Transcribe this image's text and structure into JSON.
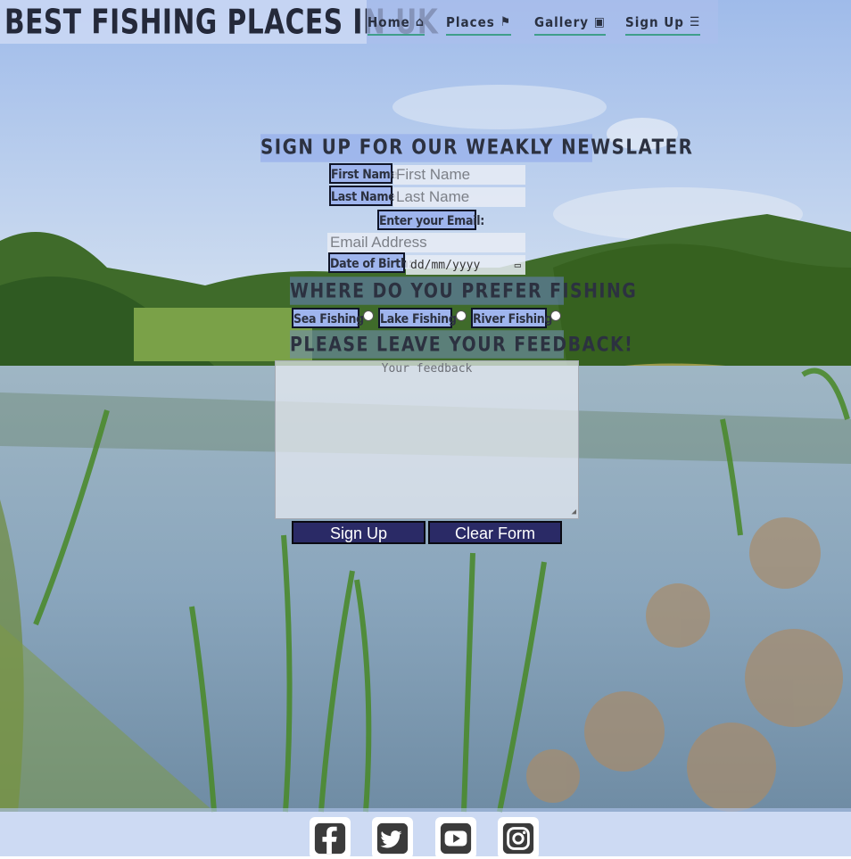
{
  "header": {
    "brand": "BEST FISHING PLACES IN UK",
    "nav": [
      {
        "label": "Home",
        "icon": "home-icon",
        "glyph": "⌂"
      },
      {
        "label": "Places",
        "icon": "map-icon",
        "glyph": "⚑"
      },
      {
        "label": "Gallery",
        "icon": "images-icon",
        "glyph": "▣"
      },
      {
        "label": "Sign Up",
        "icon": "list-icon",
        "glyph": "☰"
      }
    ]
  },
  "form": {
    "newsletter_title": "SIGN UP FOR OUR WEAKLY NEWSLATER",
    "first_name": {
      "label": "First Name",
      "placeholder": "First Name"
    },
    "last_name": {
      "label": "Last Name",
      "placeholder": "Last Name"
    },
    "email": {
      "label": "Enter your Email:",
      "placeholder": "Email Address"
    },
    "dob": {
      "label": "Date of Birth:",
      "placeholder": "dd/mm/yyyy"
    },
    "prefer_title": "WHERE DO YOU PREFER FISHING",
    "options": [
      "Sea Fishing",
      "Lake Fishing",
      "River Fishing"
    ],
    "feedback_title": "PLEASE LEAVE YOUR FEEDBACK!",
    "feedback_placeholder": "Your feedback",
    "submit_label": "Sign Up",
    "clear_label": "Clear Form"
  },
  "footer": {
    "social": [
      "facebook-icon",
      "twitter-icon",
      "youtube-icon",
      "instagram-icon"
    ]
  }
}
